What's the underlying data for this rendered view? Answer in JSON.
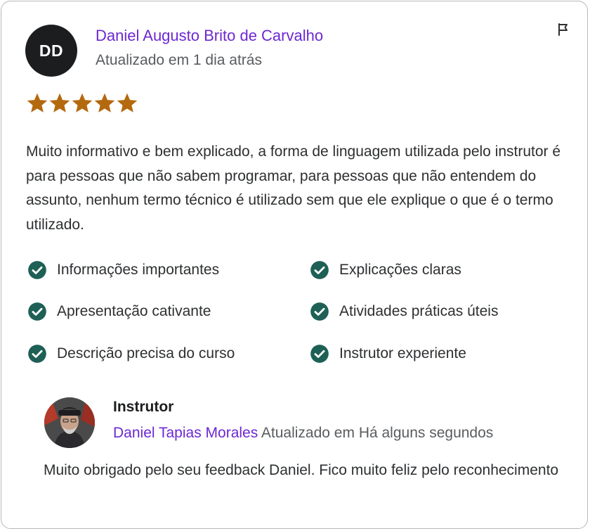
{
  "review": {
    "avatar_initials": "DD",
    "reviewer_name": "Daniel Augusto Brito de Carvalho",
    "updated": "Atualizado em 1 dia atrás",
    "rating": 5,
    "rating_max": 5,
    "star_color": "#b4690e",
    "text": "Muito informativo e bem explicado, a forma de linguagem utilizada pelo instrutor é para pessoas que não sabem programar, para pessoas que não entendem do assunto, nenhum termo técnico é utilizado sem que ele explique o que é o termo utilizado.",
    "tags": [
      "Informações importantes",
      "Explicações claras",
      "Apresentação cativante",
      "Atividades práticas úteis",
      "Descrição precisa do curso",
      "Instrutor experiente"
    ],
    "check_color": "#1e6055"
  },
  "reply": {
    "label": "Instrutor",
    "instructor_name": "Daniel Tapias Morales",
    "updated": "Atualizado em Há alguns segundos",
    "text": "Muito obrigado pelo seu feedback Daniel. Fico muito feliz pelo reconhecimento"
  },
  "icons": {
    "flag": "flag-icon",
    "star": "star-icon",
    "check": "check-circle-icon"
  },
  "colors": {
    "accent": "#6d28d2",
    "muted": "#595c5f",
    "text": "#2d2f31"
  }
}
